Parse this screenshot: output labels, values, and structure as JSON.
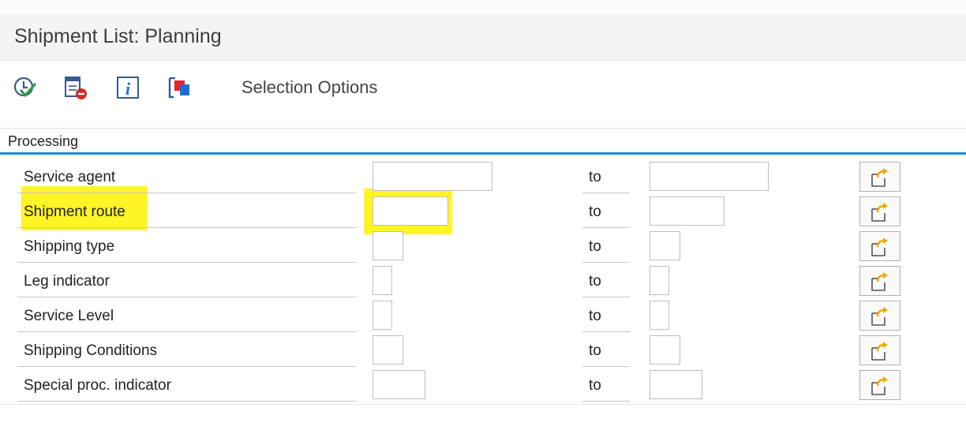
{
  "window": {
    "title": "Shipment List: Planning"
  },
  "toolbar": {
    "selection_options_label": "Selection Options",
    "icons": [
      "execute-icon",
      "delete-variant-icon",
      "info-icon",
      "copy-variant-icon"
    ]
  },
  "section": {
    "title": "Processing"
  },
  "connector": "to",
  "rows": [
    {
      "label": "Service agent",
      "from": "",
      "to": ""
    },
    {
      "label": "Shipment route",
      "from": "",
      "to": ""
    },
    {
      "label": "Shipping type",
      "from": "",
      "to": ""
    },
    {
      "label": "Leg indicator",
      "from": "",
      "to": ""
    },
    {
      "label": "Service Level",
      "from": "",
      "to": ""
    },
    {
      "label": "Shipping Conditions",
      "from": "",
      "to": ""
    },
    {
      "label": "Special proc. indicator",
      "from": "",
      "to": ""
    }
  ],
  "colors": {
    "accent": "#1a8fd6",
    "highlight": "#fff200",
    "arrow": "#f0a800"
  }
}
